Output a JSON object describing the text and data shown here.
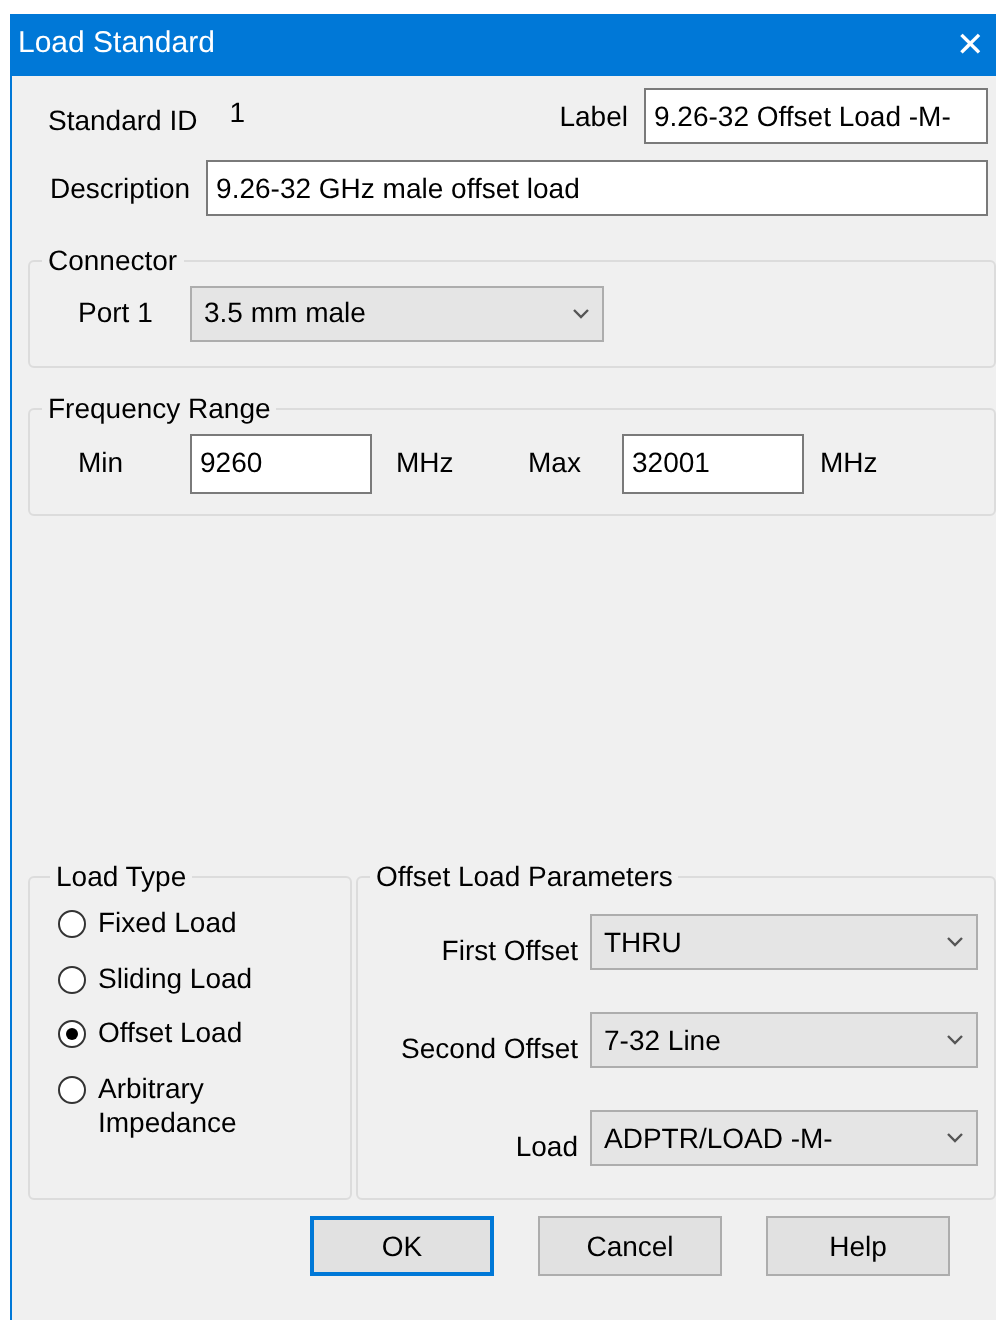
{
  "window": {
    "title": "Load Standard",
    "close": "✕"
  },
  "standard_id": {
    "label": "Standard ID",
    "value": "1"
  },
  "label_field": {
    "label": "Label",
    "value": "9.26-32 Offset Load -M-"
  },
  "description": {
    "label": "Description",
    "value": "9.26-32 GHz male offset load"
  },
  "connector": {
    "title": "Connector",
    "port_label": "Port 1",
    "port_value": "3.5 mm male"
  },
  "frequency_range": {
    "title": "Frequency Range",
    "min_label": "Min",
    "min_value": "9260",
    "min_unit": "MHz",
    "max_label": "Max",
    "max_value": "32001",
    "max_unit": "MHz"
  },
  "load_type": {
    "title": "Load Type",
    "options": [
      {
        "label": "Fixed Load",
        "selected": false
      },
      {
        "label": "Sliding Load",
        "selected": false
      },
      {
        "label": "Offset Load",
        "selected": true
      },
      {
        "label": "Arbitrary Impedance",
        "selected": false
      }
    ]
  },
  "offset_load_parameters": {
    "title": "Offset Load Parameters",
    "fields": [
      {
        "label": "First Offset",
        "value": "THRU"
      },
      {
        "label": "Second Offset",
        "value": "7-32 Line"
      },
      {
        "label": "Load",
        "value": "ADPTR/LOAD -M-"
      }
    ]
  },
  "buttons": [
    {
      "label": "OK",
      "default": true
    },
    {
      "label": "Cancel",
      "default": false
    },
    {
      "label": "Help",
      "default": false
    }
  ]
}
